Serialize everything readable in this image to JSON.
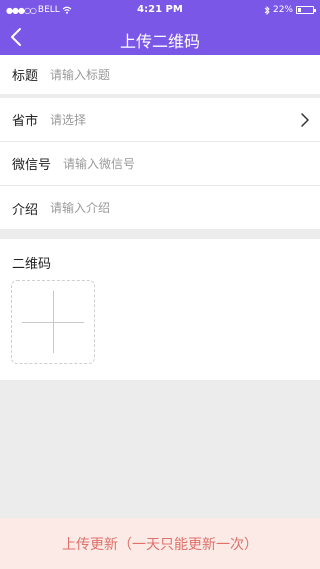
{
  "status_bar": {
    "signal": "●●●○○",
    "carrier": "BELL",
    "time": "4:21 PM",
    "battery": "22%"
  },
  "nav": {
    "title": "上传二维码"
  },
  "form": {
    "title_field": {
      "label": "标题",
      "placeholder": "请输入标题"
    },
    "region_field": {
      "label": "省市",
      "placeholder": "请选择"
    },
    "wechat_field": {
      "label": "微信号",
      "placeholder": "请输入微信号"
    },
    "intro_field": {
      "label": "介绍",
      "placeholder": "请输入介绍"
    }
  },
  "qr": {
    "label": "二维码"
  },
  "footer": {
    "submit_label": "上传更新（一天只能更新一次）"
  },
  "colors": {
    "header_bg": "#7b57e8",
    "page_bg": "#ececec",
    "footer_bg": "#fbeae6",
    "footer_text": "#e0706a"
  },
  "icons": [
    "back-icon",
    "wifi-icon",
    "bluetooth-icon",
    "battery-icon",
    "chevron-right-icon",
    "plus-icon"
  ]
}
